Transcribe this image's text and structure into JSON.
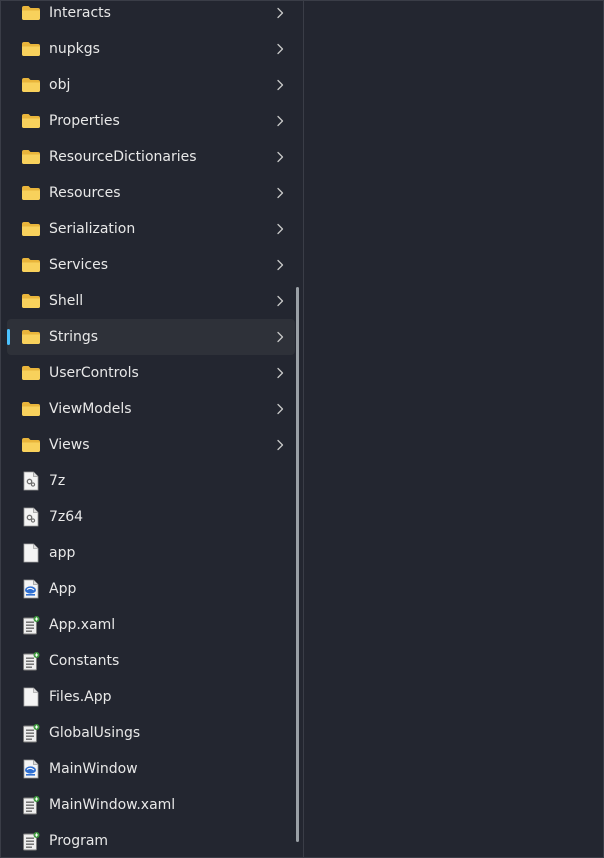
{
  "explorer": {
    "items": [
      {
        "label": "Interacts",
        "type": "folder"
      },
      {
        "label": "nupkgs",
        "type": "folder"
      },
      {
        "label": "obj",
        "type": "folder"
      },
      {
        "label": "Properties",
        "type": "folder"
      },
      {
        "label": "ResourceDictionaries",
        "type": "folder"
      },
      {
        "label": "Resources",
        "type": "folder"
      },
      {
        "label": "Serialization",
        "type": "folder"
      },
      {
        "label": "Services",
        "type": "folder"
      },
      {
        "label": "Shell",
        "type": "folder"
      },
      {
        "label": "Strings",
        "type": "folder",
        "selected": true
      },
      {
        "label": "UserControls",
        "type": "folder"
      },
      {
        "label": "ViewModels",
        "type": "folder"
      },
      {
        "label": "Views",
        "type": "folder"
      },
      {
        "label": "7z",
        "type": "dll"
      },
      {
        "label": "7z64",
        "type": "dll"
      },
      {
        "label": "app",
        "type": "blank"
      },
      {
        "label": "App",
        "type": "xaml"
      },
      {
        "label": "App.xaml",
        "type": "cs"
      },
      {
        "label": "Constants",
        "type": "cs"
      },
      {
        "label": "Files.App",
        "type": "blank"
      },
      {
        "label": "GlobalUsings",
        "type": "cs"
      },
      {
        "label": "MainWindow",
        "type": "xaml"
      },
      {
        "label": "MainWindow.xaml",
        "type": "cs"
      },
      {
        "label": "Program",
        "type": "cs"
      }
    ]
  },
  "colors": {
    "accent": "#4cc2ff",
    "folder": "#f6c84b",
    "background": "#232630",
    "selected_row": "#2e3139"
  }
}
